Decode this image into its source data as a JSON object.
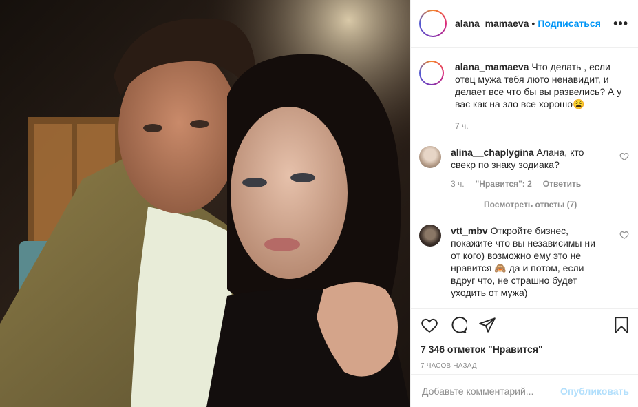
{
  "post": {
    "author": "alana_mamaeva",
    "separator": "•",
    "follow_label": "Подписаться",
    "more_label": "•••"
  },
  "caption": {
    "author": "alana_mamaeva",
    "text": "Что делать , если отец мужа тебя люто ненавидит, и делает все что бы вы развелись? А у вас как на зло все хорошо😩",
    "time": "7 ч."
  },
  "comments": [
    {
      "author": "alina__chaplygina",
      "text": "Алана, кто свекр по знаку зодиака?",
      "time": "3 ч.",
      "likes_label": "\"Нравится\": 2",
      "reply_label": "Ответить",
      "view_replies": "Посмотреть ответы (7)"
    },
    {
      "author": "vtt_mbv",
      "text": "Откройте бизнес, покажите что вы независимы ни от кого) возможно ему это не нравится 🙈 да и потом, если вдруг что, не страшно будет уходить от мужа)"
    }
  ],
  "actions": {
    "likes": "7 346 отметок \"Нравится\"",
    "posted_ago": "7 часов назад"
  },
  "add_comment": {
    "placeholder": "Добавьте комментарий...",
    "publish_label": "Опубликовать"
  },
  "colors": {
    "accent": "#0095f6",
    "publish_disabled": "#b2dffc",
    "muted": "#8e8e8e",
    "text": "#262626"
  }
}
